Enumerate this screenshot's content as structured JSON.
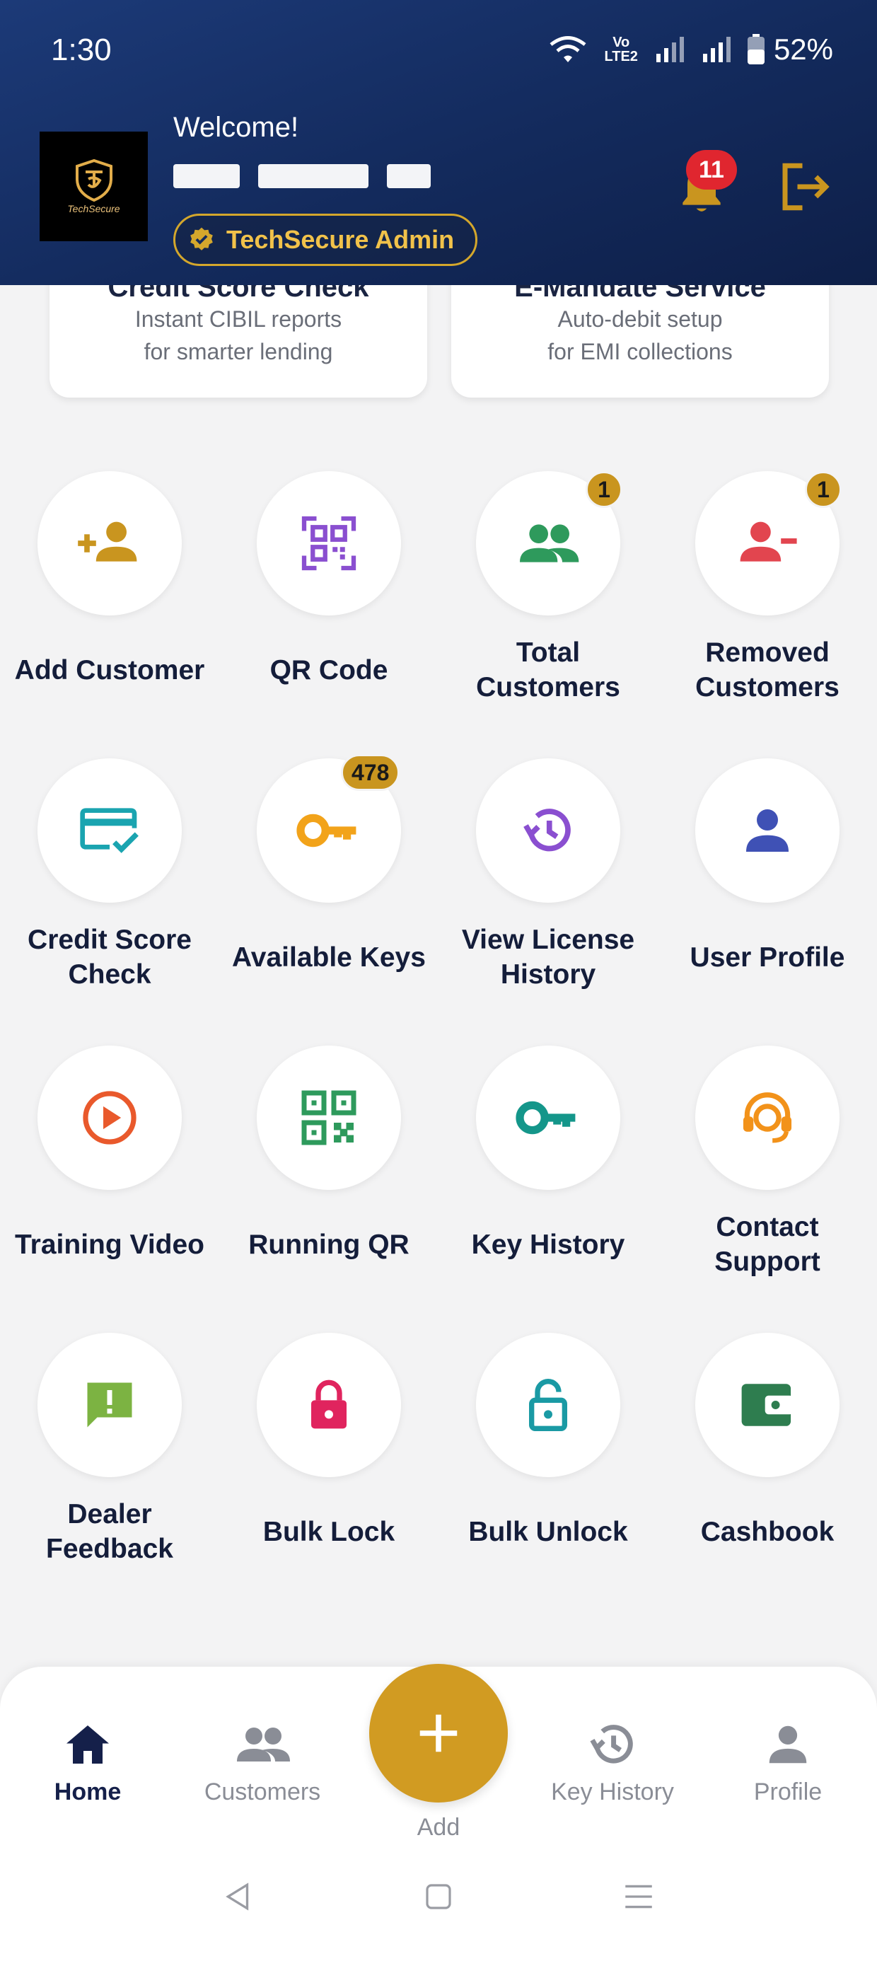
{
  "status_bar": {
    "time": "1:30",
    "volte_top": "Vo",
    "volte_bottom": "LTE2",
    "battery": "52%"
  },
  "header": {
    "logo_text": "TechSecure",
    "welcome": "Welcome!",
    "role": "TechSecure Admin",
    "notification_count": "11",
    "colors": {
      "background": "#132a5c",
      "accent": "#d4a72c"
    }
  },
  "cards": [
    {
      "title": "Credit Score Check",
      "desc_line1": "Instant CIBIL reports",
      "desc_line2": "for smarter lending"
    },
    {
      "title": "E-Mandate Service",
      "desc_line1": "Auto-debit setup",
      "desc_line2": "for EMI collections"
    }
  ],
  "grid": [
    {
      "label": "Add Customer",
      "icon": "add-person-icon",
      "color": "#c9951f",
      "badge": ""
    },
    {
      "label": "QR Code",
      "icon": "qr-scan-icon",
      "color": "#8a4fd0",
      "badge": ""
    },
    {
      "label": "Total Customers",
      "icon": "group-icon",
      "color": "#2e9a5c",
      "badge": "1"
    },
    {
      "label": "Removed Customers",
      "icon": "remove-person-icon",
      "color": "#e2454f",
      "badge": "1"
    },
    {
      "label": "Credit Score Check",
      "icon": "credit-card-check-icon",
      "color": "#1aa4b0",
      "badge": ""
    },
    {
      "label": "Available Keys",
      "icon": "key-icon",
      "color": "#f2a31a",
      "badge": "478"
    },
    {
      "label": "View License History",
      "icon": "history-icon",
      "color": "#8a4fd0",
      "badge": ""
    },
    {
      "label": "User Profile",
      "icon": "person-icon",
      "color": "#3f51b5",
      "badge": ""
    },
    {
      "label": "Training Video",
      "icon": "play-circle-icon",
      "color": "#e9592c",
      "badge": ""
    },
    {
      "label": "Running QR",
      "icon": "qr-code-icon",
      "color": "#2e9a5c",
      "badge": ""
    },
    {
      "label": "Key History",
      "icon": "key-icon",
      "color": "#14968a",
      "badge": ""
    },
    {
      "label": "Contact Support",
      "icon": "support-agent-icon",
      "color": "#f2921a",
      "badge": ""
    },
    {
      "label": "Dealer Feedback",
      "icon": "feedback-icon",
      "color": "#7cb342",
      "badge": ""
    },
    {
      "label": "Bulk Lock",
      "icon": "lock-icon",
      "color": "#e0245e",
      "badge": ""
    },
    {
      "label": "Bulk Unlock",
      "icon": "unlock-icon",
      "color": "#1a9aa4",
      "badge": ""
    },
    {
      "label": "Cashbook",
      "icon": "wallet-icon",
      "color": "#2e7d4f",
      "badge": ""
    }
  ],
  "bottom_nav": {
    "items": [
      {
        "label": "Home",
        "icon": "home-icon",
        "active": true
      },
      {
        "label": "Customers",
        "icon": "group-icon",
        "active": false
      },
      {
        "label": "Key History",
        "icon": "history-icon",
        "active": false
      },
      {
        "label": "Profile",
        "icon": "person-icon",
        "active": false
      }
    ],
    "fab_label": "Add"
  }
}
